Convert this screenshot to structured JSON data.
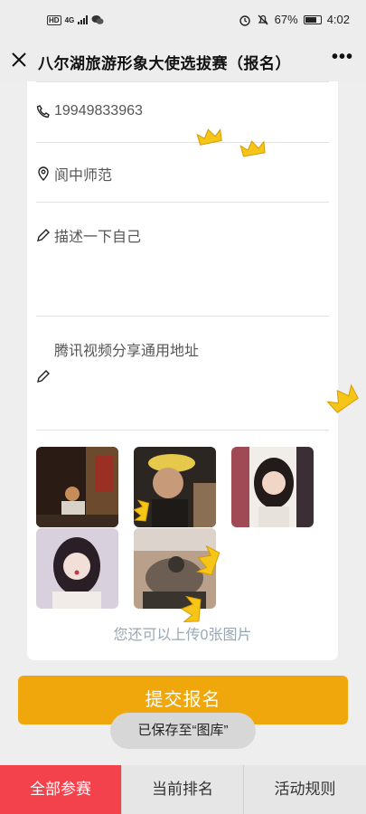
{
  "status_bar": {
    "left_badges": [
      "HD",
      "4G"
    ],
    "battery": "67%",
    "time": "4:02",
    "icons": [
      "alarm-icon",
      "mute-icon",
      "battery-icon",
      "wechat-icon"
    ]
  },
  "header": {
    "title": "八尔湖旅游形象大使选拔赛（报名）",
    "close_icon": "close-icon",
    "more_icon": "more-icon"
  },
  "form": {
    "phone": "19949833963",
    "school": "阆中师范",
    "describe_placeholder": "描述一下自己",
    "video_placeholder": "腾讯视频分享通用地址",
    "upload_hint": "您还可以上传0张图片"
  },
  "photos": [
    {
      "label": "photo-1",
      "colors": [
        "#2a1b14",
        "#6b4a2e",
        "#c68d5a"
      ]
    },
    {
      "label": "photo-2",
      "colors": [
        "#2c2622",
        "#e6c84a",
        "#8a6f55"
      ]
    },
    {
      "label": "photo-3",
      "colors": [
        "#3b2f35",
        "#f1ede8",
        "#a04a56"
      ]
    },
    {
      "label": "photo-4",
      "colors": [
        "#d9d0dd",
        "#2a1f26",
        "#f2ece8"
      ]
    },
    {
      "label": "photo-5",
      "colors": [
        "#3a342f",
        "#b9a08b",
        "#6c5e52"
      ]
    }
  ],
  "submit_label": "提交报名",
  "toast": "已保存至“图库”",
  "nav": {
    "items": [
      "全部参赛",
      "当前排名",
      "活动规则"
    ],
    "active_index": 0
  },
  "colors": {
    "accent": "#f0a70c",
    "active_tab": "#f4424d",
    "crown": "#f5c518"
  }
}
